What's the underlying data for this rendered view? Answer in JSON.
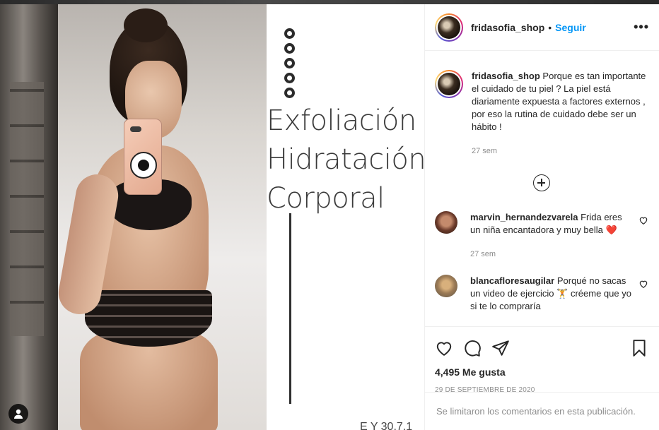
{
  "post": {
    "graphic_lines": [
      "Exfoliación",
      "Hidratación",
      "Corporal"
    ],
    "graphic_foot": "E Y 30.7.1"
  },
  "header": {
    "username": "fridasofia_shop",
    "separator": "•",
    "follow_label": "Seguir",
    "more_label": "•••"
  },
  "caption": {
    "username": "fridasofia_shop",
    "text": "Porque es tan importante el cuidado de tu piel ? La piel está diariamente expuesta a factores externos , por eso la rutina de cuidado debe ser un hábito !",
    "time": "27 sem"
  },
  "comments": [
    {
      "username": "marvin_hernandezvarela",
      "text": "Frida eres un niña encantadora y muy bella",
      "emoji": "❤️",
      "time": "27 sem"
    },
    {
      "username": "blancafloresaugilar",
      "text": "Porqué no sacas un video de ejercicio",
      "emoji": "🏋",
      "text2": "créeme que yo si te lo compraría"
    }
  ],
  "footer": {
    "likes": "4,495 Me gusta",
    "date": "29 DE SEPTIEMBRE DE 2020",
    "comments_limited": "Se limitaron los comentarios en esta publicación."
  },
  "colors": {
    "follow_blue": "#0095f6",
    "meta_gray": "#8e8e8e",
    "heart_red": "#ed4956"
  },
  "icons": [
    "profile-icon",
    "heart-icon",
    "comment-icon",
    "share-icon",
    "bookmark-icon",
    "plus-circle-icon",
    "more-icon"
  ]
}
